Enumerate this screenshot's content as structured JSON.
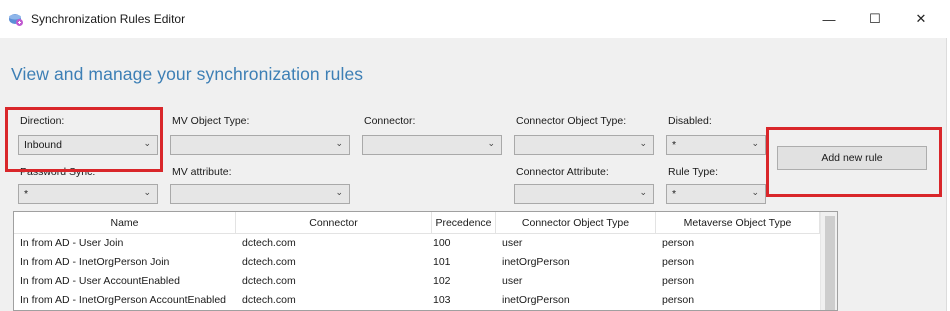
{
  "window": {
    "title": "Synchronization Rules Editor",
    "minimize_glyph": "—",
    "maximize_glyph": "☐",
    "close_glyph": "✕"
  },
  "heading": "View and manage your synchronization rules",
  "filters": {
    "direction": {
      "label": "Direction:",
      "value": "Inbound"
    },
    "mv_object_type": {
      "label": "MV Object Type:",
      "value": ""
    },
    "connector": {
      "label": "Connector:",
      "value": ""
    },
    "connector_object_type": {
      "label": "Connector Object Type:",
      "value": ""
    },
    "disabled": {
      "label": "Disabled:",
      "value": "*"
    },
    "password_sync": {
      "label": "Password Sync:",
      "value": "*"
    },
    "mv_attribute": {
      "label": "MV attribute:",
      "value": ""
    },
    "connector_attribute": {
      "label": "Connector Attribute:",
      "value": ""
    },
    "rule_type": {
      "label": "Rule Type:",
      "value": "*"
    },
    "dropdown_glyph": "⌄"
  },
  "add_button": "Add new rule",
  "grid": {
    "columns": [
      "Name",
      "Connector",
      "Precedence",
      "Connector Object Type",
      "Metaverse Object Type"
    ],
    "rows": [
      [
        "In from AD - User Join",
        "dctech.com",
        "100",
        "user",
        "person"
      ],
      [
        "In from AD - InetOrgPerson Join",
        "dctech.com",
        "101",
        "inetOrgPerson",
        "person"
      ],
      [
        "In from AD - User AccountEnabled",
        "dctech.com",
        "102",
        "user",
        "person"
      ],
      [
        "In from AD - InetOrgPerson AccountEnabled",
        "dctech.com",
        "103",
        "inetOrgPerson",
        "person"
      ]
    ]
  },
  "colors": {
    "accent": "#3d7fb5",
    "highlight": "#d9262a",
    "background": "#f0f0f0"
  }
}
